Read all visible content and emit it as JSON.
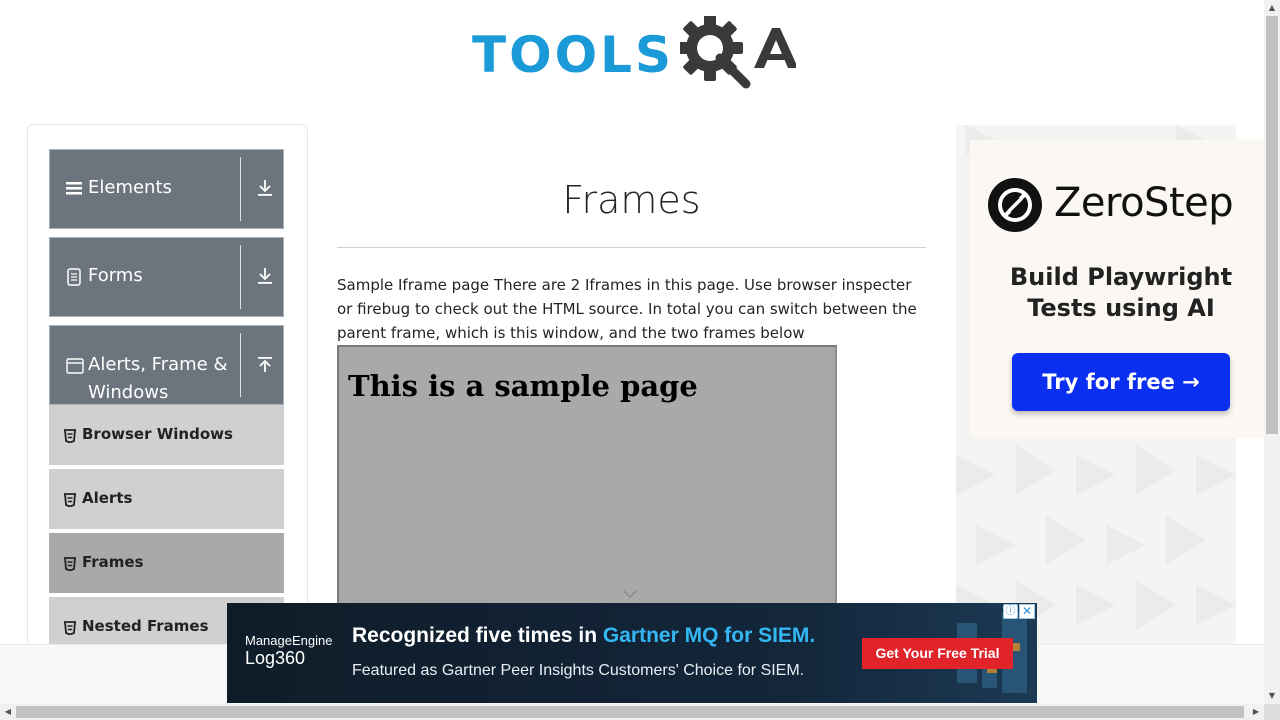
{
  "header": {
    "logo_text": "TOOLSQA"
  },
  "sidebar": {
    "groups": [
      {
        "label": "Elements",
        "icon": "hamburger-icon",
        "arrow": "download-arrow-icon"
      },
      {
        "label": "Forms",
        "icon": "document-icon",
        "arrow": "download-arrow-icon"
      },
      {
        "label": "Alerts, Frame & Windows",
        "icon": "window-icon",
        "arrow": "upload-arrow-icon"
      }
    ],
    "items": [
      {
        "label": "Browser Windows",
        "active": false
      },
      {
        "label": "Alerts",
        "active": false
      },
      {
        "label": "Frames",
        "active": true
      },
      {
        "label": "Nested Frames",
        "active": false
      }
    ]
  },
  "main": {
    "title": "Frames",
    "description": "Sample Iframe page There are 2 Iframes in this page. Use browser inspecter or firebug to check out the HTML source. In total you can switch between the parent frame, which is this window, and the two frames below",
    "iframe_heading": "This is a sample page"
  },
  "right_ad": {
    "brand": "ZeroStep",
    "tagline": "Build Playwright Tests using AI",
    "cta": "Try for free →",
    "cta_color": "#0b2ff0"
  },
  "bottom_ad": {
    "logo_top": "ManageEngine",
    "logo_bottom": "Log360",
    "headline_prefix": "Recognized five times in ",
    "headline_highlight": "Gartner MQ for SIEM.",
    "subline": "Featured as Gartner Peer Insights Customers' Choice for SIEM.",
    "cta": "Get Your Free Trial",
    "cta_color": "#e0242a",
    "info_icon": "ⓘ",
    "close_icon": "✕"
  },
  "colors": {
    "brand_blue": "#1a9ad6",
    "sidebar_group": "#6c757d",
    "menu_item": "#d0d0d0",
    "menu_item_active": "#a9a9a9"
  }
}
